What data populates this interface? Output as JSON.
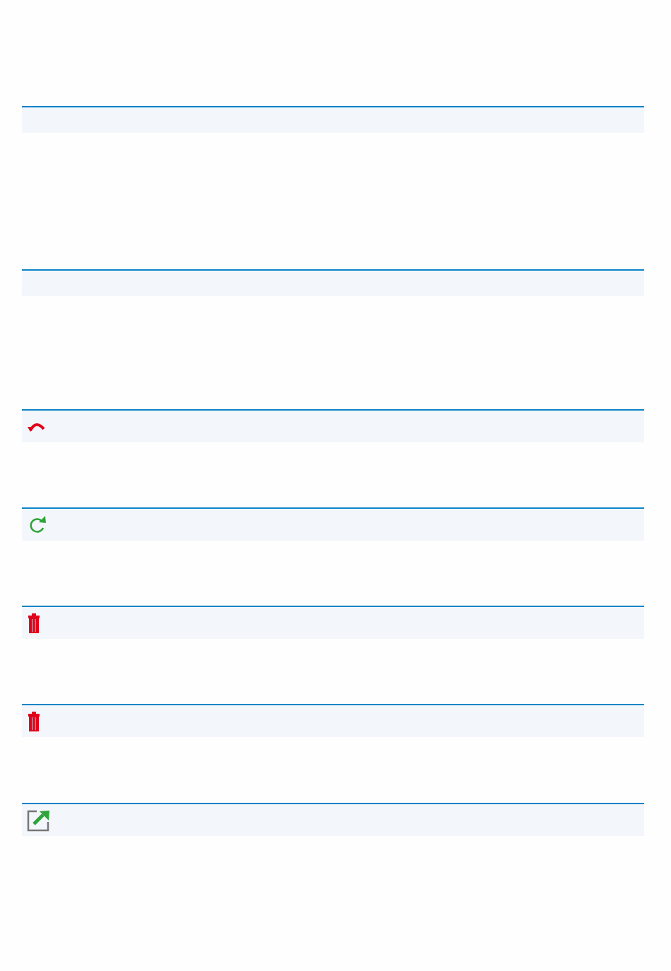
{
  "sections": [
    {
      "kind": "plain"
    },
    {
      "kind": "plain"
    },
    {
      "kind": "undo"
    },
    {
      "kind": "refresh"
    },
    {
      "kind": "delete"
    },
    {
      "kind": "delete"
    },
    {
      "kind": "external"
    }
  ]
}
